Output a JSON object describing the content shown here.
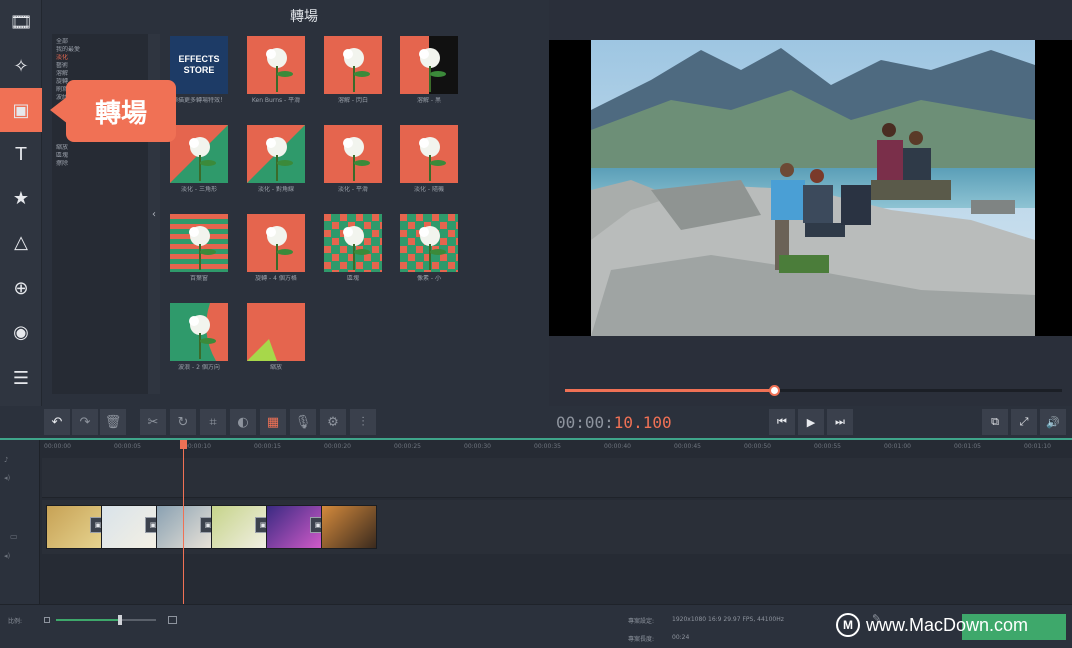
{
  "panel": {
    "title": "轉場"
  },
  "callout": {
    "label": "轉場"
  },
  "left_tools": [
    {
      "name": "import-icon",
      "glyph": "🎞"
    },
    {
      "name": "magic-wand-icon",
      "glyph": "✧"
    },
    {
      "name": "transitions-icon",
      "glyph": "▣"
    },
    {
      "name": "titles-icon",
      "glyph": "T"
    },
    {
      "name": "stickers-icon",
      "glyph": "★"
    },
    {
      "name": "callouts-icon",
      "glyph": "△"
    },
    {
      "name": "zoom-icon",
      "glyph": "⊕"
    },
    {
      "name": "record-icon",
      "glyph": "◉"
    },
    {
      "name": "more-icon",
      "glyph": "☰"
    }
  ],
  "categories": [
    {
      "label": "全部"
    },
    {
      "label": "我的最愛"
    },
    {
      "label": "淡化",
      "selected": true
    },
    {
      "label": "藝術"
    },
    {
      "label": "溶解"
    },
    {
      "label": "旋轉"
    },
    {
      "label": "刷寫"
    },
    {
      "label": "波紋"
    },
    {
      "label": "縮放"
    },
    {
      "label": "區塊"
    },
    {
      "label": "擦除"
    }
  ],
  "transitions": [
    {
      "label": "掃描更多轉場特效！",
      "style": "store",
      "store_top": "EFFECTS",
      "store_bottom": "STORE"
    },
    {
      "label": "Ken Burns - 平滑",
      "style": "flower"
    },
    {
      "label": "溶解 - 閃白",
      "style": "flower-green"
    },
    {
      "label": "溶解 - 黑",
      "style": "split"
    },
    {
      "label": "淡化 - 三角形",
      "style": "tri"
    },
    {
      "label": "淡化 - 對角線",
      "style": "diag"
    },
    {
      "label": "淡化 - 平滑",
      "style": "flower"
    },
    {
      "label": "淡化 - 隨機",
      "style": "flower"
    },
    {
      "label": "百葉窗",
      "style": "blinds"
    },
    {
      "label": "旋轉 - 4 個方格",
      "style": "flower"
    },
    {
      "label": "區塊",
      "style": "pixel"
    },
    {
      "label": "像素 - 小",
      "style": "pixel2"
    },
    {
      "label": "波浪 - 2 個方向",
      "style": "wave"
    },
    {
      "label": "縮放",
      "style": "zoom"
    }
  ],
  "playback": {
    "timecode_white": "00:00:",
    "timecode_orange": "10.100",
    "progress": 0.42
  },
  "timeline": {
    "ticks": [
      "00:00:00",
      "00:00:05",
      "00:00:10",
      "00:00:15",
      "00:00:20",
      "00:00:25",
      "00:00:30",
      "00:00:35",
      "00:00:40",
      "00:00:45",
      "00:00:50",
      "00:00:55",
      "00:01:00",
      "00:01:05",
      "00:01:10"
    ],
    "clips": [
      {
        "name": "clip-1",
        "color_a": "#c7a255",
        "color_b": "#e6d38f"
      },
      {
        "name": "clip-2",
        "color_a": "#d9e3ea",
        "color_b": "#f4f0e4"
      },
      {
        "name": "clip-3",
        "color_a": "#8aa1b2",
        "color_b": "#e8e2d8"
      },
      {
        "name": "clip-4",
        "color_a": "#c6d48a",
        "color_b": "#f1efe3"
      },
      {
        "name": "clip-5",
        "color_a": "#3a2a82",
        "color_b": "#d05ac8"
      },
      {
        "name": "clip-6",
        "color_a": "#d48a3c",
        "color_b": "#3a2a1e"
      }
    ]
  },
  "status": {
    "settings_label": "專案設定:",
    "settings_value": "1920x1080 16:9 29.97 FPS, 44100Hz",
    "length_label": "專案長度:",
    "length_value": "00:24",
    "scale_label": "比例:"
  },
  "watermark": {
    "text": "www.MacDown.com",
    "logo": "M"
  },
  "colors": {
    "accent": "#f07155",
    "export": "#3ea86b",
    "timeline_top": "#3fa58a"
  }
}
